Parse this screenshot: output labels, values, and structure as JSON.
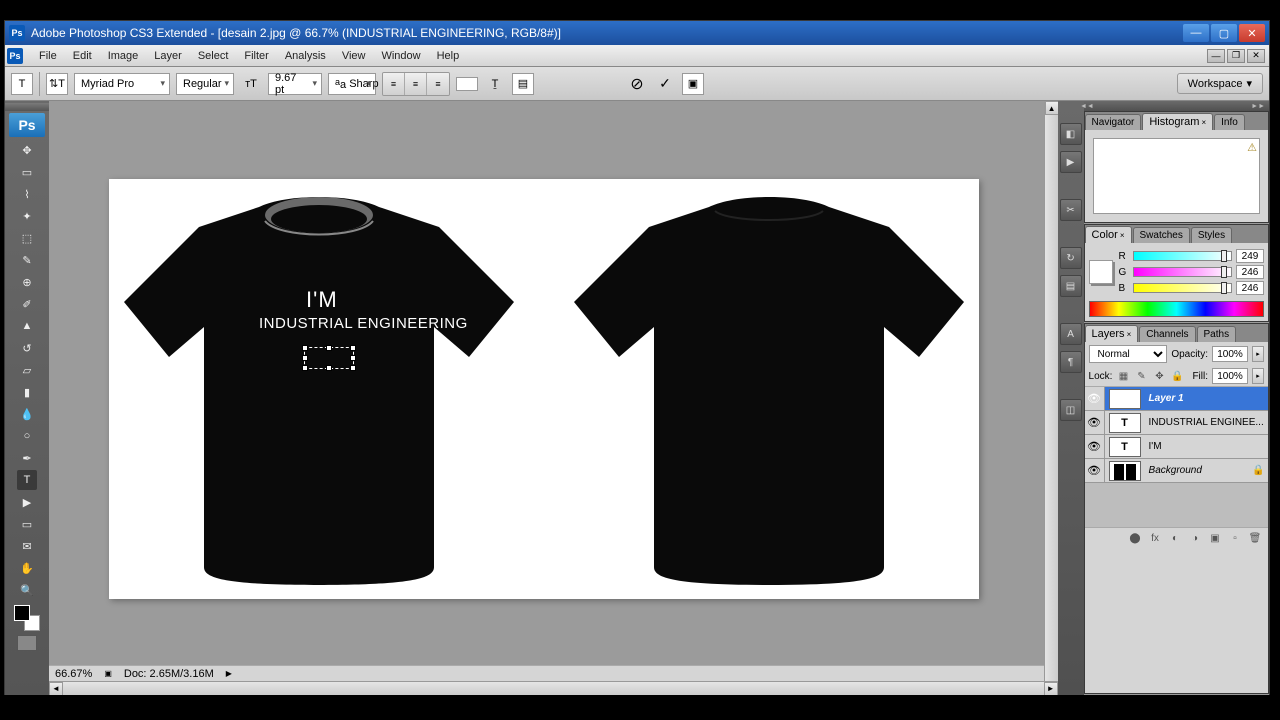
{
  "titlebar": {
    "title": "Adobe Photoshop CS3 Extended - [desain 2.jpg @ 66.7% (INDUSTRIAL ENGINEERING, RGB/8#)]"
  },
  "menubar": {
    "items": [
      "File",
      "Edit",
      "Image",
      "Layer",
      "Select",
      "Filter",
      "Analysis",
      "View",
      "Window",
      "Help"
    ]
  },
  "options": {
    "font_family": "Myriad Pro",
    "font_style": "Regular",
    "font_size": "9.67 pt",
    "aa": "Sharp",
    "workspace": "Workspace"
  },
  "canvas": {
    "text1": "I'M",
    "text2": "INDUSTRIAL ENGINEERING"
  },
  "statusbar": {
    "zoom": "66.67%",
    "doc": "Doc: 2.65M/3.16M"
  },
  "panels": {
    "nav_tabs": [
      "Navigator",
      "Histogram",
      "Info"
    ],
    "color_tabs": [
      "Color",
      "Swatches",
      "Styles"
    ],
    "rgb": {
      "r_label": "R",
      "g_label": "G",
      "b_label": "B",
      "r": "249",
      "g": "246",
      "b": "246"
    },
    "layers_tabs": [
      "Layers",
      "Channels",
      "Paths"
    ],
    "blend_mode": "Normal",
    "opacity_label": "Opacity:",
    "opacity": "100%",
    "lock_label": "Lock:",
    "fill_label": "Fill:",
    "fill": "100%",
    "layers": [
      {
        "name": "Layer 1",
        "thumb": "T",
        "selected": true
      },
      {
        "name": "INDUSTRIAL ENGINEE...",
        "thumb": "T",
        "selected": false
      },
      {
        "name": "I'M",
        "thumb": "T",
        "selected": false
      },
      {
        "name": "Background",
        "thumb": "bg",
        "selected": false,
        "locked": true
      }
    ]
  }
}
